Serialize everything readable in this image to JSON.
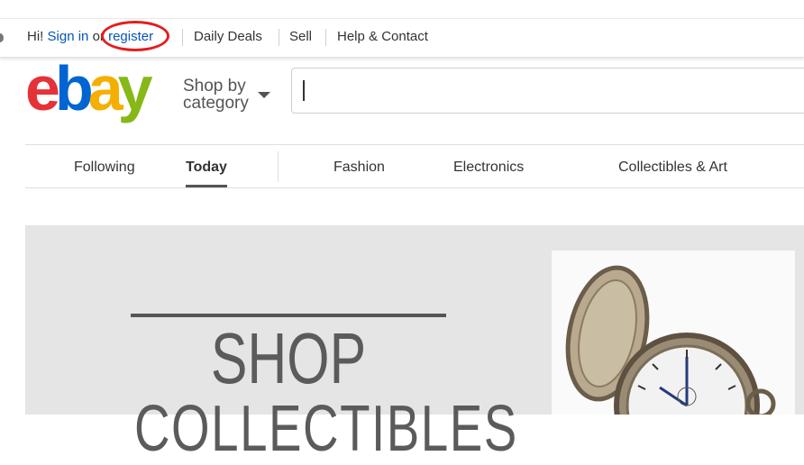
{
  "topbar": {
    "greeting": "Hi!",
    "sign_in": "Sign in",
    "or": "or",
    "register": "register",
    "links": [
      "Daily Deals",
      "Sell",
      "Help & Contact"
    ]
  },
  "header": {
    "logo": [
      "e",
      "b",
      "a",
      "y"
    ],
    "shop_by_line1": "Shop by",
    "shop_by_line2": "category",
    "search_value": ""
  },
  "nav": {
    "tabs": [
      "Following",
      "Today",
      "Fashion",
      "Electronics",
      "Collectibles & Art"
    ],
    "active": "Today"
  },
  "hero": {
    "title": "SHOP",
    "subtitle": "COLLECTIBLES",
    "image": "pocket-watch"
  },
  "colors": {
    "link": "#0654ba",
    "annotation_circle": "#e41e1e",
    "logo_e": "#e53238",
    "logo_b": "#0064d2",
    "logo_a": "#f5af02",
    "logo_y": "#86b817",
    "hero_bg": "#e5e5e5"
  }
}
